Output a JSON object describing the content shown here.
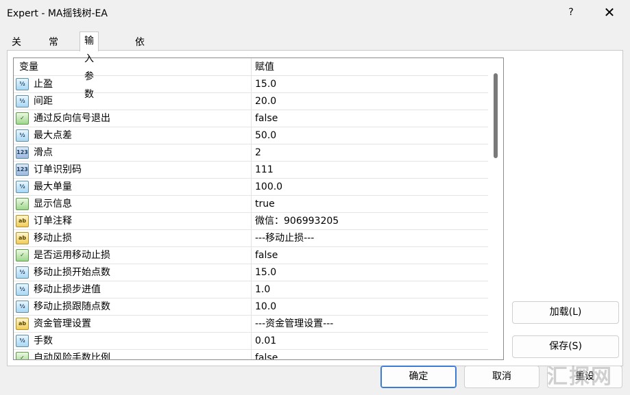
{
  "window": {
    "title": "Expert - MA摇钱树-EA",
    "help": "?",
    "close": "✕"
  },
  "tabs": [
    "关于",
    "常用",
    "输入参数",
    "依存关系"
  ],
  "grid": {
    "col_variable": "变量",
    "col_value": "赋值",
    "rows": [
      {
        "name": "止盈",
        "value": "15.0",
        "type": "dbl",
        "icon": "½"
      },
      {
        "name": "间距",
        "value": "20.0",
        "type": "dbl",
        "icon": "½"
      },
      {
        "name": "通过反向信号退出",
        "value": "false",
        "type": "bool",
        "icon": "✓"
      },
      {
        "name": "最大点差",
        "value": "50.0",
        "type": "dbl",
        "icon": "½"
      },
      {
        "name": "滑点",
        "value": "2",
        "type": "int",
        "icon": "123"
      },
      {
        "name": "订单识别码",
        "value": "111",
        "type": "int",
        "icon": "123"
      },
      {
        "name": "最大单量",
        "value": "100.0",
        "type": "dbl",
        "icon": "½"
      },
      {
        "name": "显示信息",
        "value": "true",
        "type": "bool",
        "icon": "✓"
      },
      {
        "name": "订单注释",
        "value": "微信：906993205",
        "type": "str",
        "icon": "ab"
      },
      {
        "name": "移动止损",
        "value": "---移动止损---",
        "type": "str",
        "icon": "ab"
      },
      {
        "name": "是否运用移动止损",
        "value": "false",
        "type": "bool",
        "icon": "✓"
      },
      {
        "name": "移动止损开始点数",
        "value": "15.0",
        "type": "dbl",
        "icon": "½"
      },
      {
        "name": "移动止损步进值",
        "value": "1.0",
        "type": "dbl",
        "icon": "½"
      },
      {
        "name": "移动止损跟随点数",
        "value": "10.0",
        "type": "dbl",
        "icon": "½"
      },
      {
        "name": "资金管理设置",
        "value": "---资金管理设置---",
        "type": "str",
        "icon": "ab"
      },
      {
        "name": "手数",
        "value": "0.01",
        "type": "dbl",
        "icon": "½"
      },
      {
        "name": "自动风险手数比例",
        "value": "false",
        "type": "bool",
        "icon": "✓"
      }
    ]
  },
  "buttons": {
    "load": "加载(L)",
    "save": "保存(S)",
    "ok": "确定",
    "cancel": "取消",
    "reset": "重设"
  },
  "watermark": "汇探网"
}
